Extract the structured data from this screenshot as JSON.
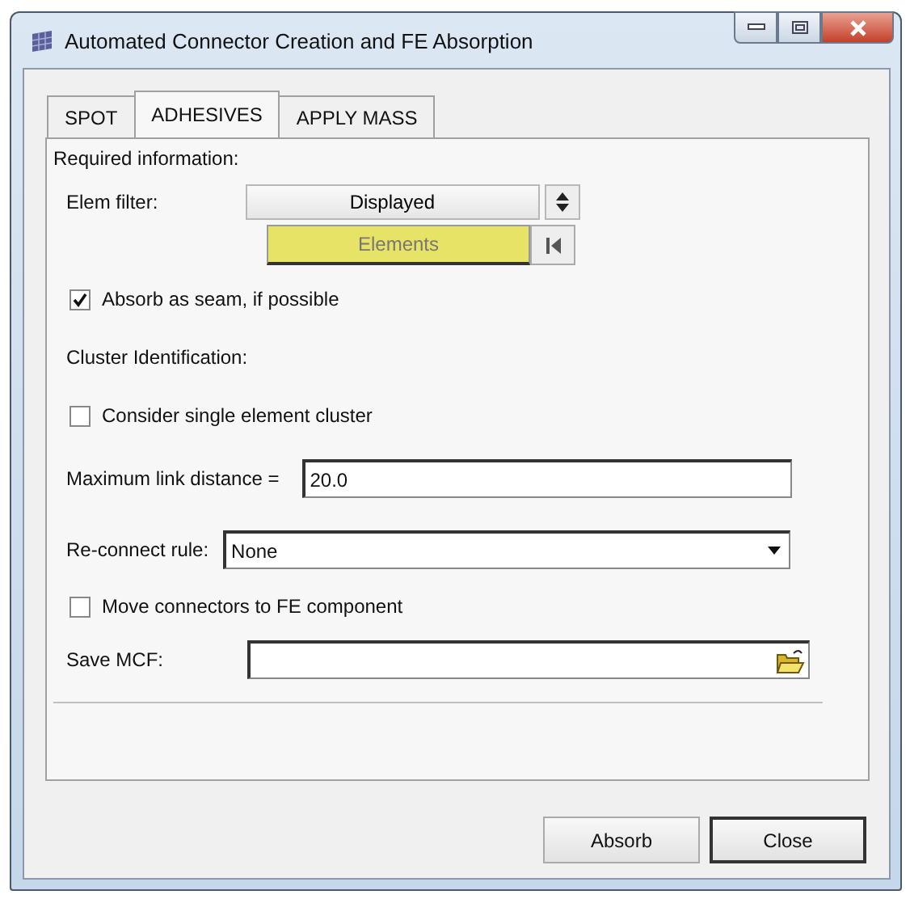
{
  "window": {
    "title": "Automated Connector Creation and FE Absorption"
  },
  "tabs": [
    {
      "label": "SPOT",
      "selected": false
    },
    {
      "label": "ADHESIVES",
      "selected": true
    },
    {
      "label": "APPLY MASS",
      "selected": false
    }
  ],
  "section_label": "Required information:",
  "elem_filter": {
    "label": "Elem filter:",
    "value": "Displayed"
  },
  "entity_selector": {
    "label": "Elements",
    "active": true
  },
  "absorb_seam": {
    "label": "Absorb as seam, if possible",
    "checked": true
  },
  "cluster_label": "Cluster Identification:",
  "single_cluster": {
    "label": "Consider single element cluster",
    "checked": false
  },
  "max_link": {
    "label": "Maximum link distance =",
    "value": "20.0"
  },
  "reconnect": {
    "label": "Re-connect rule:",
    "value": "None"
  },
  "move_connectors": {
    "label": "Move connectors to FE component",
    "checked": false
  },
  "save_mcf": {
    "label": "Save MCF:"
  },
  "buttons": [
    {
      "label": "Absorb",
      "default": false
    },
    {
      "label": "Close",
      "default": true
    }
  ]
}
